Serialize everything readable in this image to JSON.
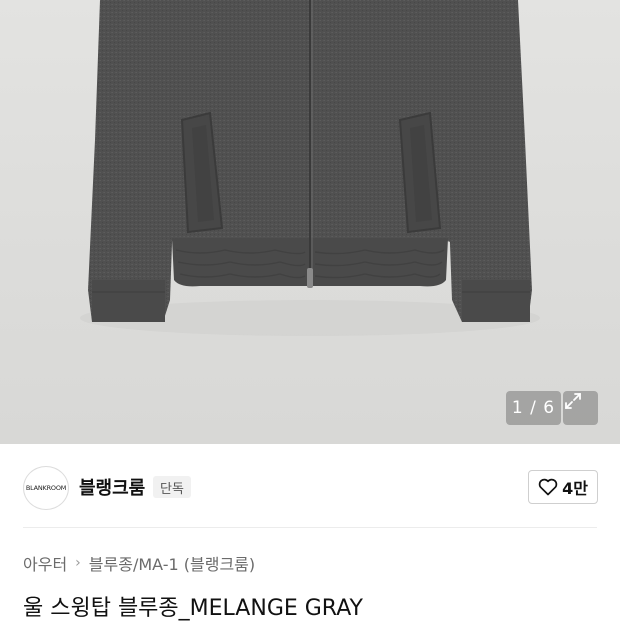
{
  "gallery": {
    "counter": "1 / 6",
    "expand_icon": "expand-arrows-icon"
  },
  "brand": {
    "logo_text": "BLANKROOM",
    "name": "블랭크룸",
    "badge": "단독"
  },
  "like": {
    "icon": "heart-outline-icon",
    "count": "4만"
  },
  "breadcrumb": {
    "items": [
      "아우터",
      "블루종/MA-1 (블랭크룸)"
    ]
  },
  "product": {
    "title": "울 스윙탑 블루종_MELANGE GRAY"
  },
  "colors": {
    "jacket": "#4f4f4f",
    "background": "#dedede"
  }
}
